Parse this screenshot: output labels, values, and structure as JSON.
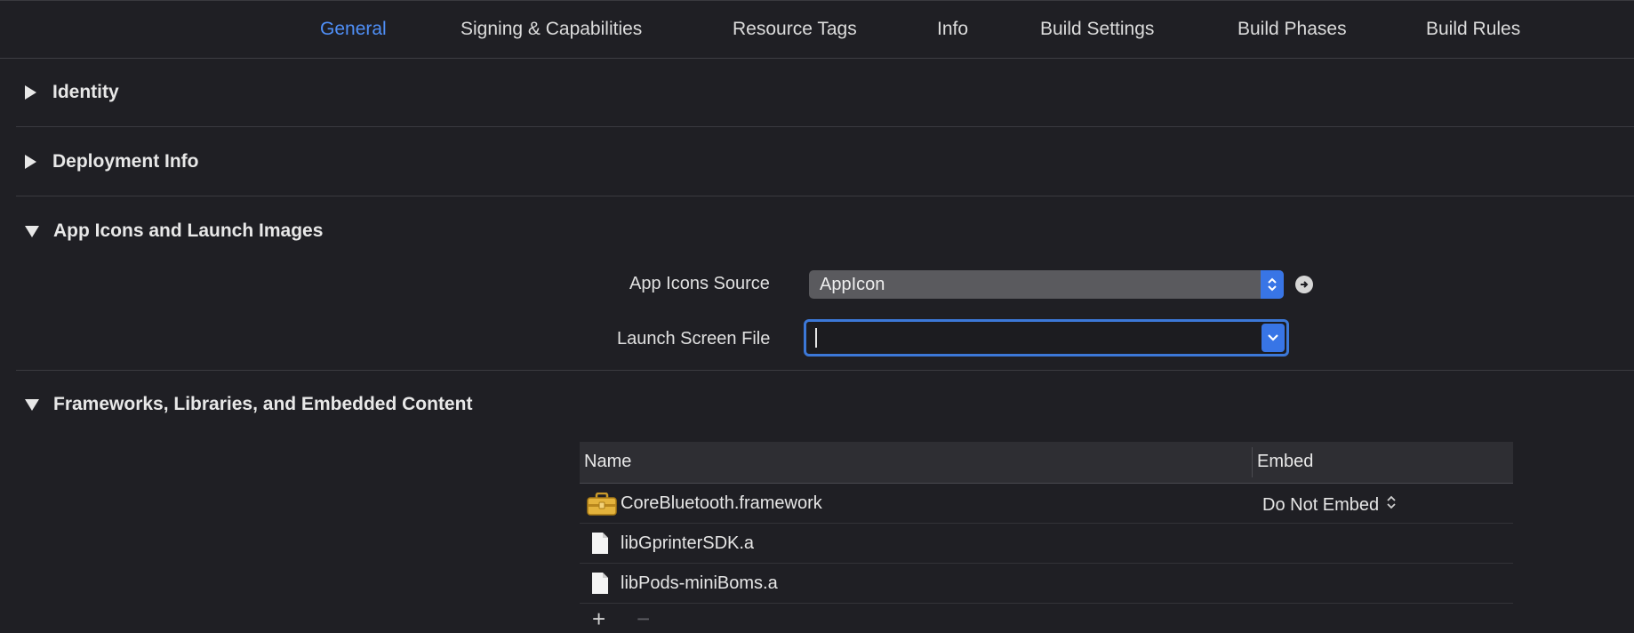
{
  "tabs": [
    {
      "label": "General",
      "active": true
    },
    {
      "label": "Signing & Capabilities"
    },
    {
      "label": "Resource Tags"
    },
    {
      "label": "Info"
    },
    {
      "label": "Build Settings"
    },
    {
      "label": "Build Phases"
    },
    {
      "label": "Build Rules"
    }
  ],
  "sections": {
    "identity": "Identity",
    "deployment": "Deployment Info",
    "app_icons": "App Icons and Launch Images",
    "frameworks": "Frameworks, Libraries, and Embedded Content"
  },
  "app_icons": {
    "source_label": "App Icons Source",
    "source_value": "AppIcon",
    "launch_label": "Launch Screen File",
    "launch_value": ""
  },
  "frameworks_table": {
    "col_name": "Name",
    "col_embed": "Embed",
    "rows": [
      {
        "name": "CoreBluetooth.framework",
        "embed": "Do Not Embed",
        "icon": "toolbox-icon"
      },
      {
        "name": "libGprinterSDK.a",
        "embed": "",
        "icon": "file-icon"
      },
      {
        "name": "libPods-miniBoms.a",
        "embed": "",
        "icon": "file-icon"
      }
    ],
    "add": "+",
    "remove": "−"
  },
  "colors": {
    "accent": "#4f8ff7",
    "background": "#1f1f24",
    "popup_blue": "#3875e6"
  }
}
